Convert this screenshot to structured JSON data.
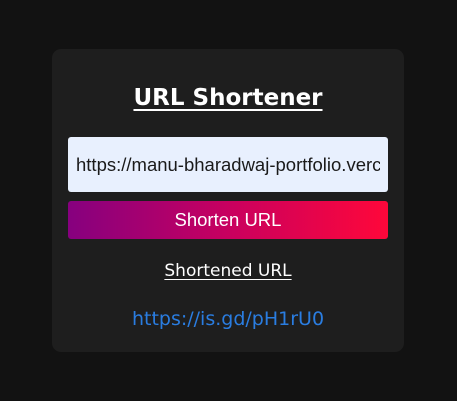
{
  "app": {
    "title": "URL Shortener"
  },
  "form": {
    "url_value": "https://manu-bharadwaj-portfolio.vercel.app",
    "submit_label": "Shorten URL"
  },
  "result": {
    "label": "Shortened URL",
    "short_url": "https://is.gd/pH1rU0"
  },
  "colors": {
    "page_background": "#121212",
    "card_background": "#1e1e1e",
    "input_background": "#e8f0fe",
    "button_gradient_start": "#86007f",
    "button_gradient_end": "#ff073a",
    "link_color": "#2a7de1"
  }
}
